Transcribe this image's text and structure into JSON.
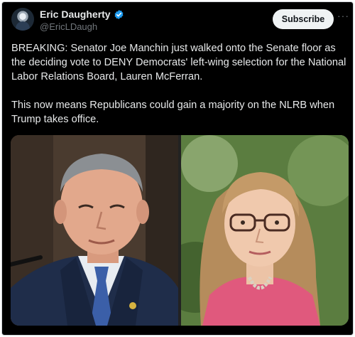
{
  "tweet": {
    "author": {
      "display_name": "Eric Daugherty",
      "handle": "@EricLDaugh",
      "verified_icon": "verified-badge-icon",
      "verified_color": "#1d9bf0"
    },
    "subscribe_label": "Subscribe",
    "more_label": "···",
    "text_paragraphs": [
      "BREAKING: Senator Joe Manchin just walked onto the Senate floor as the deciding vote to DENY Democrats' left-wing selection for the National Labor Relations Board, Lauren McFerran.",
      "This now means Republicans could gain a majority on the NLRB when Trump takes office."
    ],
    "media": [
      {
        "icon": "portrait-photo",
        "subject": "man-in-suit"
      },
      {
        "icon": "portrait-photo",
        "subject": "woman-with-glasses"
      }
    ]
  },
  "theme": {
    "background": "#000000",
    "text": "#e7e9ea",
    "secondary_text": "#71767b",
    "button_bg": "#eff3f4"
  }
}
